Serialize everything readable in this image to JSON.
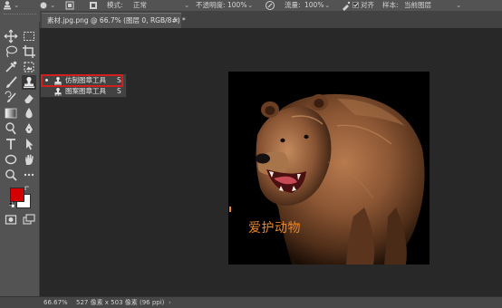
{
  "options_bar": {
    "mode_label": "模式:",
    "mode_value": "正常",
    "opacity_label": "不透明度:",
    "opacity_value": "100%",
    "flow_label": "流量:",
    "flow_value": "100%",
    "aligned_label": "对齐",
    "aligned_checked": true,
    "sample_label": "样本:",
    "sample_value": "当前图层"
  },
  "document_tab": {
    "title": "素材.jpg.png @ 66.7% (图层 0, RGB/8#) *",
    "close_glyph": "×"
  },
  "tool_flyout": {
    "items": [
      {
        "label": "仿制图章工具",
        "shortcut": "S",
        "icon": "clone-stamp-icon",
        "selected": true
      },
      {
        "label": "图案图章工具",
        "shortcut": "S",
        "icon": "pattern-stamp-icon",
        "selected": false
      }
    ],
    "highlight_color": "#d11e1e"
  },
  "canvas": {
    "watermark_text": "爱护动物",
    "watermark_color": "#e8862c",
    "image_subject": "brown bear roaring"
  },
  "colors": {
    "foreground": "#d40000",
    "background": "#ffffff",
    "accent_red": "#d11e1e"
  },
  "status_bar": {
    "zoom": "66.67%",
    "doc_info": "527 像素 x 503 像素 (96 ppi)",
    "arrow": "›"
  }
}
